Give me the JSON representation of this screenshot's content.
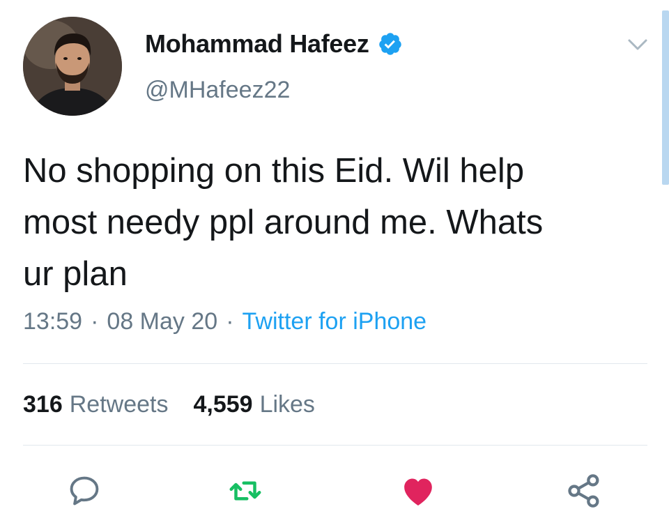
{
  "tweet": {
    "author": {
      "display_name": "Mohammad Hafeez",
      "handle": "@MHafeez22",
      "verified": true
    },
    "text": "No shopping on this Eid. Wil help\nmost needy ppl around me. Whats\nur plan",
    "time": "13:59",
    "separator": "·",
    "date": "08 May 20",
    "source": "Twitter for iPhone",
    "stats": {
      "retweets_count": "316",
      "retweets_label": "Retweets",
      "likes_count": "4,559",
      "likes_label": "Likes"
    },
    "actions": {
      "reply_icon": "reply-icon",
      "retweet_icon": "retweet-icon",
      "like_icon": "heart-icon",
      "share_icon": "share-icon"
    }
  },
  "colors": {
    "accent": "#1da1f2",
    "retweet": "#17bf63",
    "like": "#e0245e",
    "secondary_text": "#657786",
    "divider": "#e1e8ed",
    "scrollbar": "#b9d7f0"
  }
}
